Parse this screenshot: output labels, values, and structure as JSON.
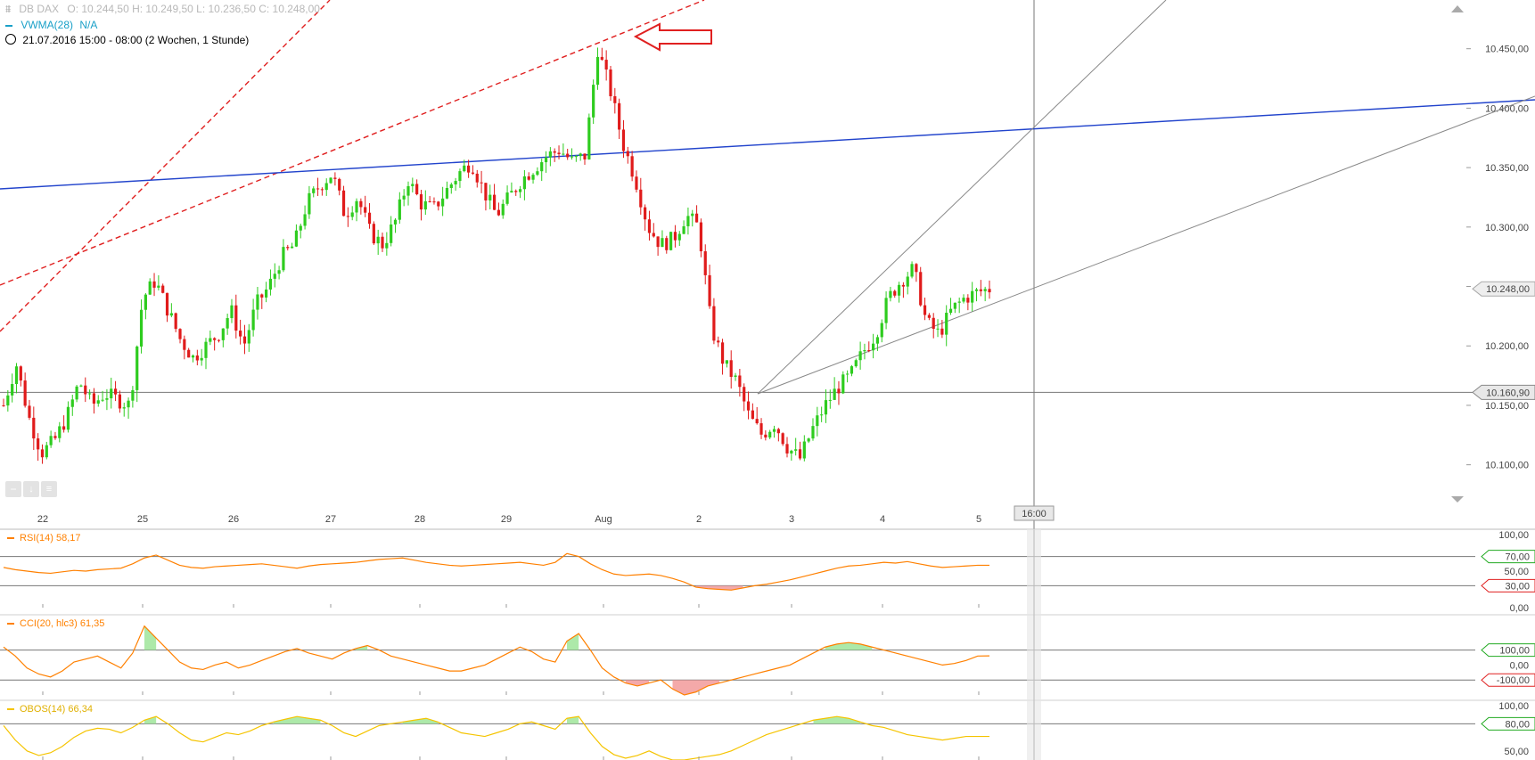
{
  "header": {
    "instrument": "DB DAX",
    "ohlc": "O: 10.244,50  H: 10.249,50  L: 10.236,50  C: 10.248,00",
    "vwma_label": "VWMA(28)",
    "vwma_value": "N/A",
    "period": "21.07.2016 15:00 - 08:00 (2 Wochen, 1 Stunde)"
  },
  "colors": {
    "up": "#2ecc1f",
    "down": "#e01b1b",
    "trend_red": "#e02020",
    "trend_blue": "#2244cc",
    "trend_gray": "#888888",
    "rsi": "#ff8000",
    "cci": "#ff8000",
    "obos": "#f5c400",
    "osc_fill_green": "#9fe59a",
    "osc_fill_red": "#f29a9a",
    "vwma": "#1aa0c8"
  },
  "x_axis": {
    "labels": [
      "22",
      "25",
      "26",
      "27",
      "28",
      "29",
      "Aug",
      "2",
      "3",
      "4",
      "5"
    ],
    "crosshair_time": "16:00"
  },
  "chart_data": [
    {
      "type": "candlestick",
      "name": "DB DAX",
      "ylim": [
        10075,
        10485
      ],
      "y_ticks": [
        "10.100,00",
        "10.150,00",
        "10.200,00",
        "10.250,00",
        "10.300,00",
        "10.350,00",
        "10.400,00",
        "10.450,00"
      ],
      "y_tick_values": [
        10100,
        10150,
        10200,
        10250,
        10300,
        10350,
        10400,
        10450
      ],
      "last_price_label": "10.248,00",
      "last_price": 10248,
      "horizontal_line_label": "10.160,90",
      "horizontal_line": 10160.9,
      "crosshair_price": 10377,
      "candles_note": "hourly OHLC, 21.07.2016 to 05.08.2016",
      "anchors": [
        10150,
        10185,
        10140,
        10110,
        10120,
        10140,
        10170,
        10150,
        10160,
        10155,
        10150,
        10240,
        10255,
        10230,
        10205,
        10190,
        10200,
        10210,
        10230,
        10200,
        10235,
        10250,
        10275,
        10285,
        10320,
        10335,
        10345,
        10310,
        10325,
        10295,
        10285,
        10305,
        10340,
        10320,
        10315,
        10330,
        10345,
        10355,
        10330,
        10310,
        10325,
        10340,
        10350,
        10360,
        10365,
        10355,
        10360,
        10450,
        10415,
        10370,
        10340,
        10300,
        10285,
        10290,
        10310,
        10300,
        10215,
        10185,
        10170,
        10140,
        10125,
        10135,
        10115,
        10105,
        10130,
        10150,
        10165,
        10175,
        10195,
        10210,
        10240,
        10255,
        10265,
        10220,
        10210,
        10230,
        10240,
        10245,
        10248
      ],
      "trend_lines": [
        {
          "color": "red",
          "dashed": true,
          "from": [
            0,
            10158
          ],
          "to": [
            1.0,
            10485
          ]
        },
        {
          "color": "red",
          "dashed": true,
          "from": [
            0,
            10240
          ],
          "to": [
            1.0,
            10470
          ]
        },
        {
          "color": "blue",
          "dashed": false,
          "from": [
            0,
            10334
          ],
          "to": [
            1.0,
            10400
          ]
        },
        {
          "color": "gray",
          "dashed": false,
          "from": [
            0,
            10165
          ],
          "to": [
            1.0,
            10485
          ]
        },
        {
          "color": "gray",
          "dashed": false,
          "from": [
            0,
            10165
          ],
          "to": [
            1.0,
            10410
          ]
        }
      ]
    },
    {
      "type": "line",
      "name": "RSI(14)",
      "label": "RSI(14)",
      "value_label": "58,17",
      "ylim": [
        0,
        100
      ],
      "y_ticks": [
        "100,00",
        "50,00",
        "0,00"
      ],
      "y_tick_values": [
        100,
        50,
        0
      ],
      "levels": [
        70,
        30
      ],
      "level_labels": [
        "70,00",
        "30,00"
      ],
      "values": [
        55,
        52,
        50,
        48,
        47,
        49,
        51,
        50,
        52,
        53,
        54,
        60,
        68,
        72,
        65,
        58,
        55,
        54,
        56,
        57,
        58,
        59,
        60,
        58,
        56,
        54,
        57,
        59,
        60,
        61,
        62,
        64,
        66,
        67,
        68,
        65,
        62,
        60,
        58,
        57,
        58,
        59,
        60,
        61,
        62,
        60,
        58,
        62,
        74,
        70,
        60,
        52,
        46,
        44,
        45,
        46,
        44,
        40,
        35,
        28,
        26,
        25,
        24,
        27,
        30,
        32,
        35,
        38,
        42,
        46,
        50,
        54,
        57,
        58,
        60,
        62,
        61,
        63,
        60,
        57,
        55,
        56,
        57,
        58,
        58
      ]
    },
    {
      "type": "line",
      "name": "CCI(20, hlc3)",
      "label": "CCI(20, hlc3)",
      "value_label": "61,35",
      "ylim": [
        -200,
        300
      ],
      "levels": [
        100,
        -100
      ],
      "level_labels": [
        "100,00",
        "-100,00"
      ],
      "y_ticks": [
        "0,00"
      ],
      "y_tick_values": [
        0
      ],
      "values": [
        120,
        60,
        -20,
        -60,
        -80,
        -40,
        20,
        40,
        60,
        20,
        -20,
        80,
        260,
        180,
        100,
        20,
        -20,
        -30,
        0,
        20,
        -20,
        0,
        30,
        60,
        90,
        110,
        80,
        60,
        40,
        80,
        110,
        130,
        100,
        60,
        40,
        20,
        0,
        -20,
        -40,
        -40,
        -20,
        0,
        40,
        80,
        120,
        90,
        40,
        20,
        160,
        210,
        100,
        -20,
        -80,
        -120,
        -140,
        -120,
        -100,
        -160,
        -200,
        -180,
        -140,
        -120,
        -100,
        -80,
        -60,
        -40,
        -20,
        0,
        40,
        80,
        120,
        140,
        150,
        140,
        120,
        100,
        80,
        60,
        40,
        20,
        0,
        10,
        30,
        60,
        61
      ]
    },
    {
      "type": "line",
      "name": "OBOS(14)",
      "label": "OBOS(14)",
      "value_label": "66,34",
      "ylim": [
        40,
        100
      ],
      "levels": [
        80
      ],
      "level_labels": [
        "80,00"
      ],
      "y_ticks": [
        "100,00",
        "50,00"
      ],
      "y_tick_values": [
        100,
        50
      ],
      "values": [
        78,
        62,
        50,
        45,
        48,
        55,
        65,
        72,
        75,
        74,
        70,
        76,
        84,
        88,
        80,
        70,
        62,
        60,
        65,
        70,
        68,
        72,
        78,
        82,
        85,
        88,
        86,
        84,
        78,
        70,
        66,
        72,
        78,
        80,
        82,
        84,
        86,
        82,
        76,
        70,
        68,
        66,
        70,
        74,
        80,
        82,
        78,
        74,
        86,
        88,
        70,
        55,
        46,
        42,
        45,
        50,
        44,
        40,
        40,
        42,
        44,
        46,
        50,
        56,
        62,
        68,
        72,
        76,
        80,
        84,
        86,
        88,
        86,
        82,
        78,
        76,
        72,
        68,
        66,
        64,
        62,
        64,
        66,
        66,
        66
      ]
    }
  ],
  "toolbar": {
    "buttons": [
      "minus-icon",
      "download-icon",
      "menu-icon"
    ]
  }
}
